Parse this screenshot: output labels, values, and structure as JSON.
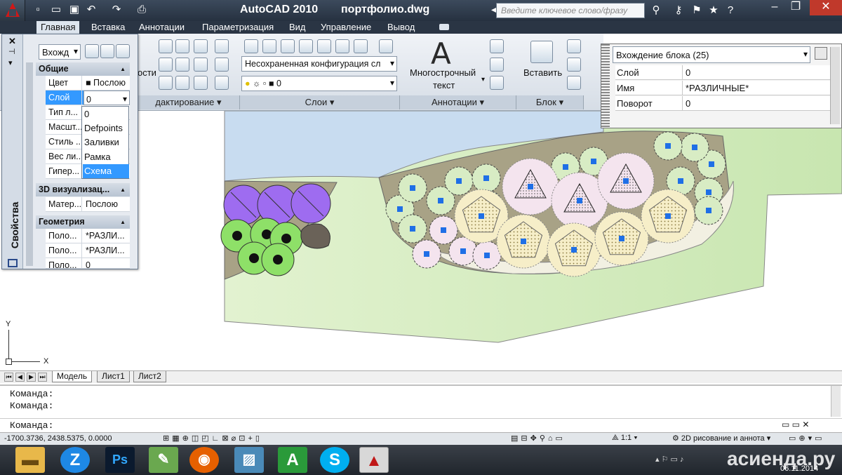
{
  "app": {
    "title": "AutoCAD 2010",
    "file": "портфолио.dwg"
  },
  "search": {
    "placeholder": "Введите ключевое слово/фразу"
  },
  "menu": [
    "Главная",
    "Вставка",
    "Аннотации",
    "Параметризация",
    "Вид",
    "Управление",
    "Вывод"
  ],
  "ribbon": {
    "sections": {
      "edit": "дактирование",
      "layers": "Слои",
      "annotations": "Аннотации",
      "block": "Блок"
    },
    "partial_label": "ости",
    "layer_config": "Несохраненная конфигурация сл",
    "layer_current": "0",
    "mtext_label": "Многострочный",
    "mtext_label2": "текст",
    "insert_label": "Вставить"
  },
  "props": {
    "vertical_title": "Свойства",
    "selector": "Вхожд",
    "sections": {
      "general": "Общие",
      "viz": "3D визуализац...",
      "geom": "Геометрия"
    },
    "general": [
      {
        "label": "Цвет",
        "value": "■ Послою"
      },
      {
        "label": "Слой",
        "value": "0"
      },
      {
        "label": "Тип л...",
        "value": ""
      },
      {
        "label": "Масшт...",
        "value": ""
      },
      {
        "label": "Стиль ...",
        "value": ""
      },
      {
        "label": "Вес ли...",
        "value": ""
      },
      {
        "label": "Гипер...",
        "value": ""
      }
    ],
    "viz": [
      {
        "label": "Матер...",
        "value": "Послою"
      }
    ],
    "geom": [
      {
        "label": "Поло...",
        "value": "*РАЗЛИ..."
      },
      {
        "label": "Поло...",
        "value": "*РАЗЛИ..."
      },
      {
        "label": "Поло...",
        "value": "0"
      }
    ]
  },
  "layer_dropdown": [
    "0",
    "Defpoints",
    "Заливки",
    "Рамка",
    "Схема"
  ],
  "block_panel": {
    "title": "Вхождение блока (25)",
    "rows": [
      {
        "label": "Слой",
        "value": "0"
      },
      {
        "label": "Имя",
        "value": "*РАЗЛИЧНЫЕ*"
      },
      {
        "label": "Поворот",
        "value": "0"
      }
    ]
  },
  "axes": {
    "y": "Y",
    "x": "X"
  },
  "layout_tabs": [
    "Модель",
    "Лист1",
    "Лист2"
  ],
  "commands": [
    "Команда:",
    "Команда:",
    "Команда:"
  ],
  "status": {
    "coords": "-1700.3736, 2438.5375, 0.0000",
    "scale": "1:1",
    "workspace": "2D рисование и аннота"
  },
  "taskbar": {
    "date": "06.11.2014",
    "watermark": "асиенда.ру"
  },
  "colors": {
    "lawn": "#e2f2d0",
    "water": "#c8dcf0",
    "soil": "#a8a286",
    "path": "#f2f0e2",
    "purple": "#9e6cf0",
    "green": "#8ee068",
    "shrub": "#d8ecc4",
    "pink": "#f4e4ee",
    "tan": "#f6eec8",
    "marker": "#1f6fe6"
  }
}
